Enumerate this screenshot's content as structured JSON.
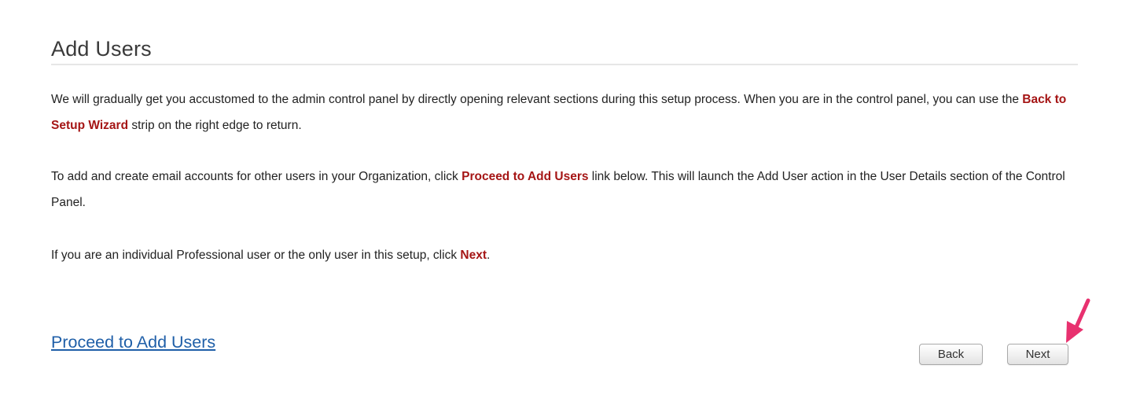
{
  "page": {
    "title": "Add Users"
  },
  "paragraphs": {
    "p1": {
      "t1": "We will gradually get you accustomed to the admin control panel by directly opening relevant sections during this setup process. When you are in the control panel, you can use the ",
      "h1": "Back to Setup Wizard",
      "t2": " strip on the right edge to return."
    },
    "p2": {
      "t1": "To add and create email accounts for other users in your Organization, click ",
      "h1": "Proceed to Add Users",
      "t2": " link below. This will launch the Add User action in the User Details section of the Control Panel."
    },
    "p3": {
      "t1": "If you are an individual Professional user or the only user in this setup, click ",
      "h1": "Next",
      "t2": "."
    }
  },
  "actions": {
    "proceed_link": "Proceed to Add Users",
    "back_label": "Back",
    "next_label": "Next"
  },
  "colors": {
    "highlight": "#a51515",
    "link": "#1f5fa8",
    "annotation_arrow": "#e8316f"
  },
  "icons": {
    "annotation": "pointer-arrow-icon"
  }
}
